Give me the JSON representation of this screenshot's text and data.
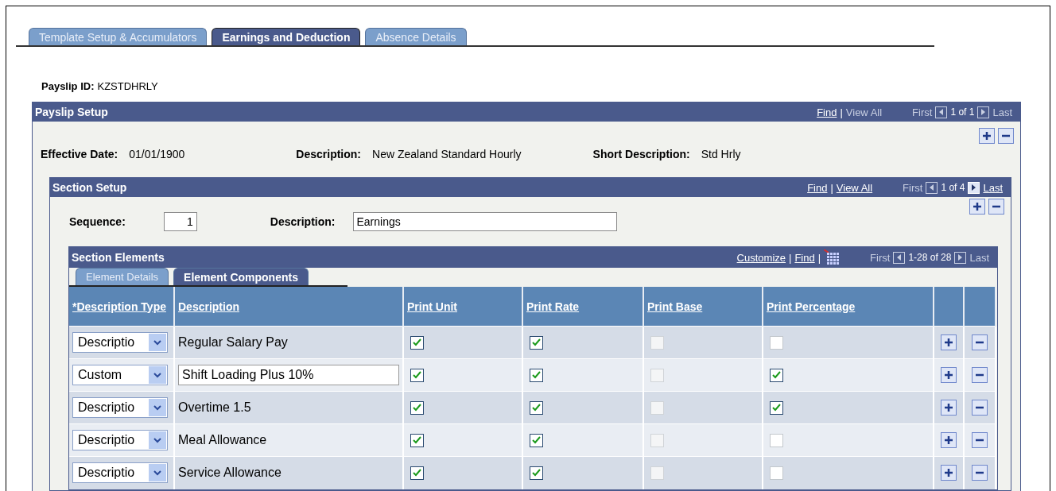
{
  "tabs": [
    {
      "label": "Template Setup & Accumulators",
      "selected": false
    },
    {
      "label": "Earnings and Deduction",
      "selected": true
    },
    {
      "label": "Absence Details",
      "selected": false
    }
  ],
  "payslip_id": {
    "label": "Payslip ID:",
    "value": "KZSTDHRLY"
  },
  "payslip_setup": {
    "title": "Payslip Setup",
    "nav": {
      "separator": "|",
      "links": [
        {
          "text": "Find",
          "enabled": true
        },
        {
          "text": "View All",
          "enabled": false
        }
      ],
      "first": {
        "text": "First",
        "enabled": false
      },
      "prev_enabled": false,
      "count": "1 of 1",
      "next_enabled": false,
      "last": {
        "text": "Last",
        "enabled": false
      }
    },
    "fields": [
      {
        "label": "Effective Date:",
        "value": "01/01/1900"
      },
      {
        "label": "Description:",
        "value": "New Zealand Standard Hourly"
      },
      {
        "label": "Short Description:",
        "value": "Std Hrly"
      }
    ]
  },
  "section_setup": {
    "title": "Section Setup",
    "nav": {
      "separator": "|",
      "links": [
        {
          "text": "Find",
          "enabled": true
        },
        {
          "text": "View All",
          "enabled": true
        }
      ],
      "first": {
        "text": "First",
        "enabled": false
      },
      "prev_enabled": false,
      "count": "1 of 4",
      "next_enabled": true,
      "last": {
        "text": "Last",
        "enabled": true
      }
    },
    "sequence": {
      "label": "Sequence:",
      "value": "1"
    },
    "description": {
      "label": "Description:",
      "value": "Earnings"
    }
  },
  "section_elements": {
    "title": "Section Elements",
    "nav": {
      "separator": "|",
      "links": [
        {
          "text": "Customize",
          "enabled": true
        },
        {
          "text": "Find",
          "enabled": true
        }
      ],
      "grid_button": true,
      "first": {
        "text": "First",
        "enabled": false
      },
      "prev_enabled": false,
      "count": "1-28 of 28",
      "next_enabled": false,
      "last": {
        "text": "Last",
        "enabled": false
      }
    },
    "tabs": [
      {
        "label": "Element Details",
        "selected": false
      },
      {
        "label": "Element Components",
        "selected": true
      }
    ],
    "columns": [
      "*Description Type",
      "Description",
      "Print Unit",
      "Print Rate",
      "Print Base",
      "Print Percentage"
    ],
    "rows": [
      {
        "type": "Descriptio",
        "kind": "text",
        "description": "Regular Salary Pay",
        "print_unit": {
          "checked": true,
          "disabled": false
        },
        "print_rate": {
          "checked": true,
          "disabled": false
        },
        "print_base": {
          "checked": false,
          "disabled": true
        },
        "print_percentage": {
          "checked": false,
          "disabled": false
        }
      },
      {
        "type": "Custom",
        "kind": "input",
        "description": "Shift Loading Plus 10%",
        "print_unit": {
          "checked": true,
          "disabled": false
        },
        "print_rate": {
          "checked": true,
          "disabled": false
        },
        "print_base": {
          "checked": false,
          "disabled": true
        },
        "print_percentage": {
          "checked": true,
          "disabled": false
        }
      },
      {
        "type": "Descriptio",
        "kind": "text",
        "description": "Overtime 1.5",
        "print_unit": {
          "checked": true,
          "disabled": false
        },
        "print_rate": {
          "checked": true,
          "disabled": false
        },
        "print_base": {
          "checked": false,
          "disabled": true
        },
        "print_percentage": {
          "checked": true,
          "disabled": false
        }
      },
      {
        "type": "Descriptio",
        "kind": "text",
        "description": "Meal Allowance",
        "print_unit": {
          "checked": true,
          "disabled": false
        },
        "print_rate": {
          "checked": true,
          "disabled": false
        },
        "print_base": {
          "checked": false,
          "disabled": true
        },
        "print_percentage": {
          "checked": false,
          "disabled": false
        }
      },
      {
        "type": "Descriptio",
        "kind": "text",
        "description": "Service Allowance",
        "print_unit": {
          "checked": true,
          "disabled": false
        },
        "print_rate": {
          "checked": true,
          "disabled": false
        },
        "print_base": {
          "checked": false,
          "disabled": true
        },
        "print_percentage": {
          "checked": false,
          "disabled": false
        }
      }
    ]
  }
}
